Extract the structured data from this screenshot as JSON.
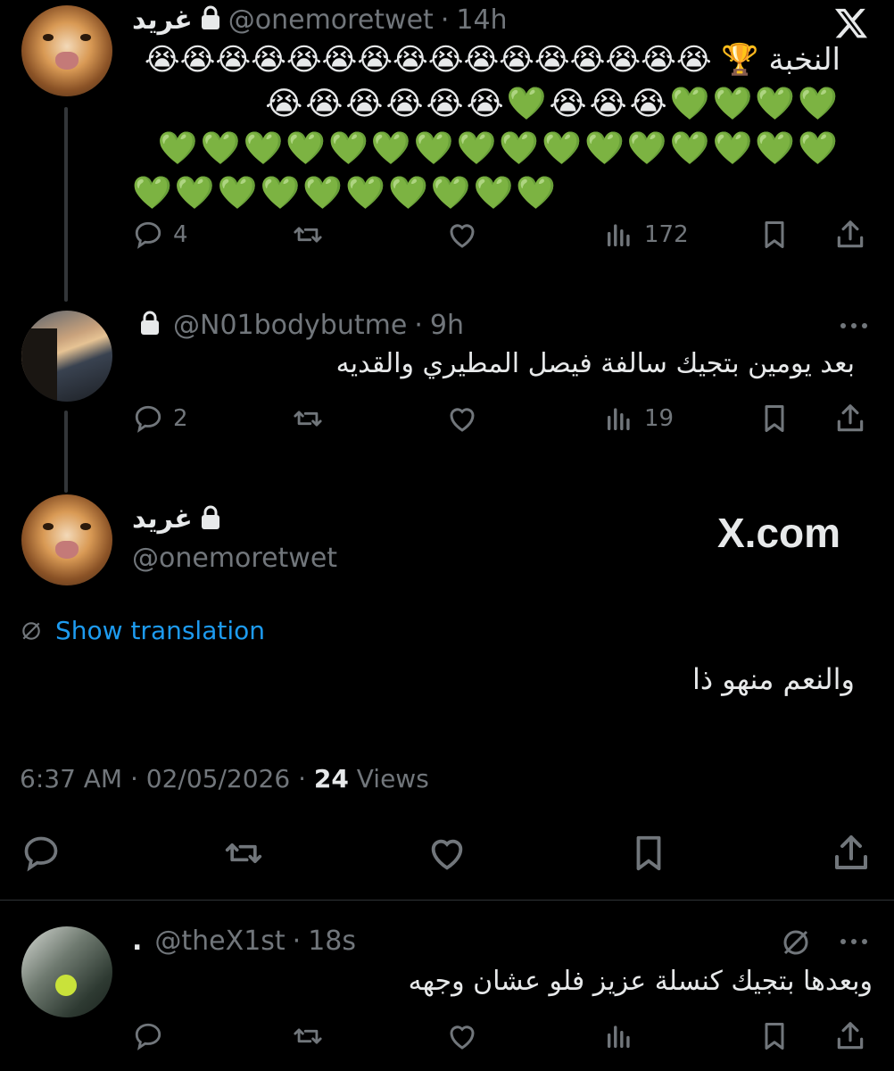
{
  "tweet1": {
    "name": "غريد",
    "handle": "@onemoretwet",
    "time": "14h",
    "text_line1": "النخبة 🏆 😭😭😭😭😭😭😭😭😭😭😭😭😭😭😭😭",
    "text_line2": "💚💚💚💚😭😭😭💚😭😭😭😭😭😭",
    "text_line3": "💚💚💚💚💚💚💚💚💚💚💚💚💚💚💚💚",
    "text_line4": "💚💚💚💚💚💚💚💚💚💚",
    "replies": "4",
    "views": "172"
  },
  "tweet2": {
    "handle": "@N01bodybutme",
    "time": "9h",
    "text": "بعد يومين بتجيك سالفة فيصل المطيري والقديه",
    "replies": "2",
    "views": "19"
  },
  "main_tweet": {
    "name": "غريد",
    "handle": "@onemoretwet",
    "show_translation": "Show translation",
    "text": "والنعم منهو ذا",
    "watermark": "X.com",
    "timestamp": "6:37 AM · 02/05/2026 · ",
    "views_count": "24",
    "views_label": " Views"
  },
  "tweet3": {
    "name": ".",
    "handle": "@theX1st",
    "time": "18s",
    "text": "وبعدها بتجيك كنسلة عزيز فلو عشان وجهه"
  },
  "icons": [
    "x-logo-icon",
    "lock-icon",
    "reply-icon",
    "retweet-icon",
    "like-icon",
    "views-icon",
    "bookmark-icon",
    "share-icon",
    "more-icon",
    "translate-icon"
  ],
  "colors": {
    "background": "#000000",
    "text": "#e7e9ea",
    "muted": "#71767b",
    "link": "#1d9bf0"
  }
}
